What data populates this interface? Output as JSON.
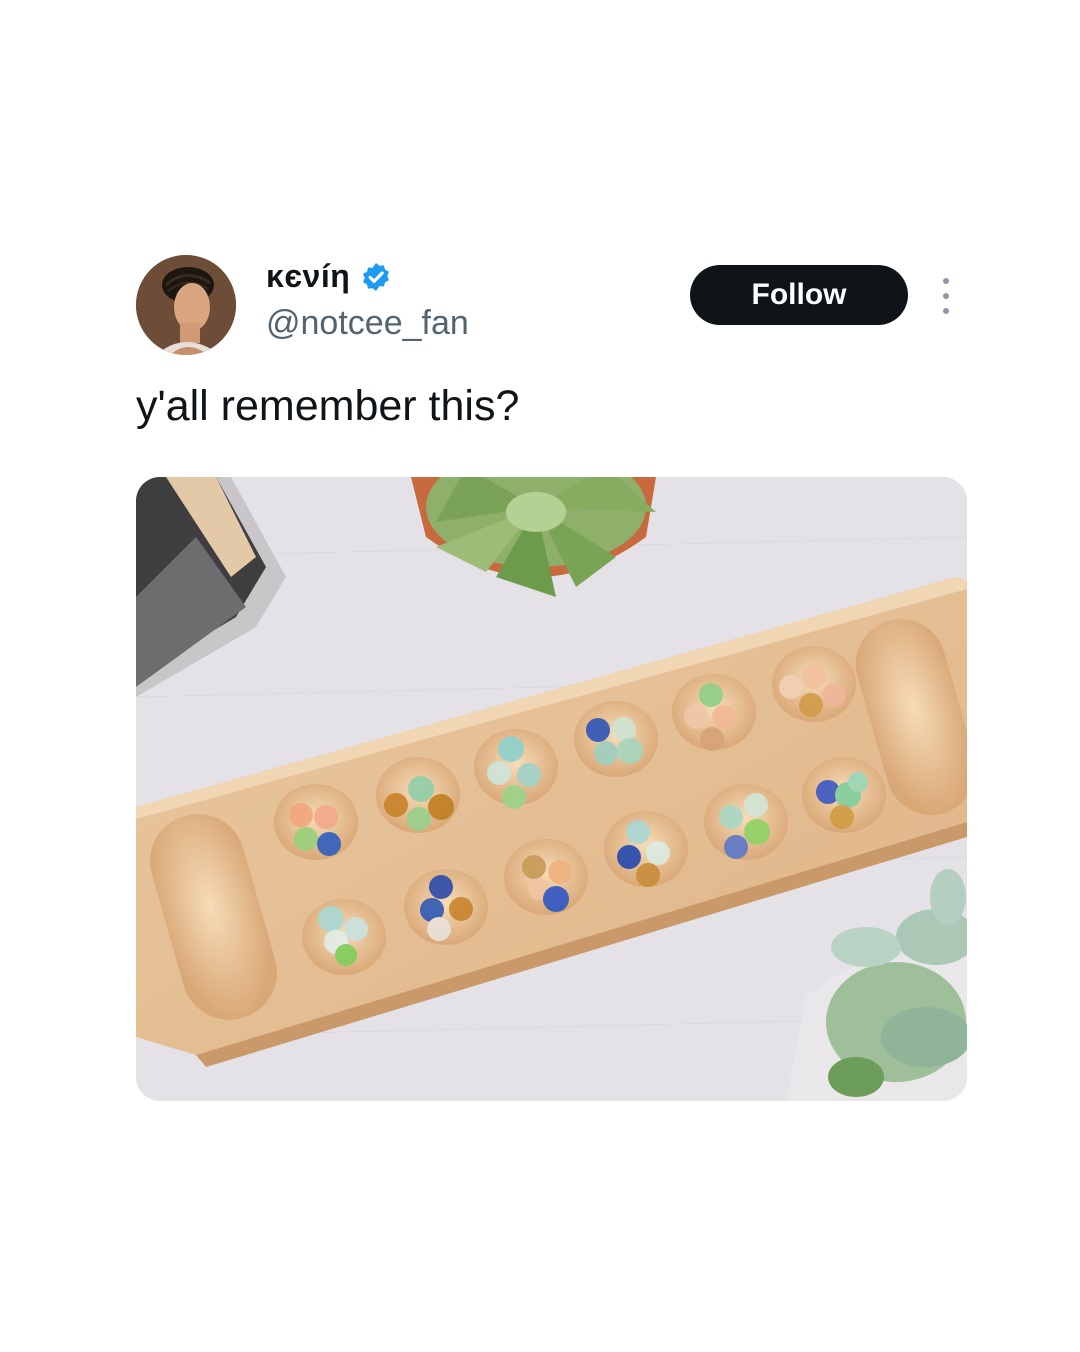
{
  "tweet": {
    "author": {
      "display_name": "κєνíη",
      "handle": "@notcee_fan",
      "verified": true,
      "avatar_icon": "user-avatar-photo"
    },
    "follow_label": "Follow",
    "more_icon": "more-vertical-icon",
    "text": "y'all remember this?",
    "media": {
      "kind": "photo",
      "subject": "wooden mancala board with glass stones, succulents and books"
    }
  },
  "colors": {
    "follow_bg": "#0f1419",
    "follow_text": "#ffffff",
    "verified_badge": "#1d9bf0",
    "primary_text": "#0f1419",
    "secondary_text": "#536471"
  }
}
